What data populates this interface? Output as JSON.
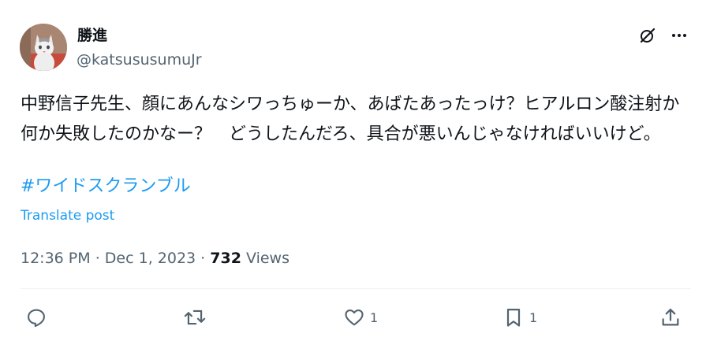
{
  "author": {
    "display_name": "勝進",
    "handle": "@katsususumuJr"
  },
  "tweet": {
    "text": "中野信子先生、顔にあんなシワっちゅーか、あばたあったっけ？ヒアルロン酸注射か何か失敗したのかなー？　どうしたんだろ、具合が悪いんじゃなければいいけど。",
    "hashtag": "#ワイドスクランブル",
    "translate_label": "Translate post"
  },
  "meta": {
    "time": "12:36 PM",
    "separator": "·",
    "date": "Dec 1, 2023",
    "views_count": "732",
    "views_label": "Views"
  },
  "actions": {
    "reply_icon": "reply-icon",
    "retweet_icon": "retweet-icon",
    "like_icon": "heart-icon",
    "like_count": "1",
    "bookmark_icon": "bookmark-icon",
    "bookmark_count": "1",
    "share_icon": "share-icon"
  },
  "colors": {
    "link": "#1d9bf0",
    "secondary_text": "#536471",
    "primary_text": "#0f1419"
  }
}
